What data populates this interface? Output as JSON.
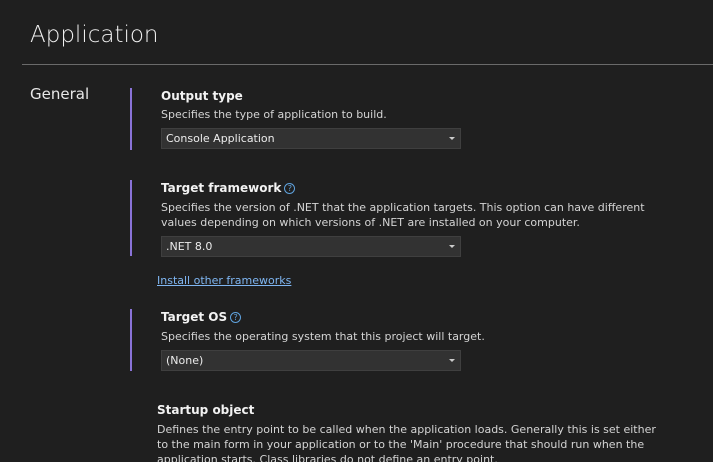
{
  "header": {
    "title": "Application"
  },
  "section": {
    "name": "General"
  },
  "output_type": {
    "label": "Output type",
    "description": "Specifies the type of application to build.",
    "selected": "Console Application"
  },
  "target_framework": {
    "label": "Target framework",
    "description": "Specifies the version of .NET that the application targets. This option can have different values depending on which versions of .NET are installed on your computer.",
    "selected": ".NET 8.0",
    "install_link": "Install other frameworks"
  },
  "target_os": {
    "label": "Target OS",
    "description": "Specifies the operating system that this project will target.",
    "selected": "(None)"
  },
  "startup_object": {
    "label": "Startup object",
    "description": "Defines the entry point to be called when the application loads. Generally this is set either to the main form in your application or to the 'Main' procedure that should run when the application starts. Class libraries do not define an entry point."
  },
  "icons": {
    "help": "help-icon",
    "dropdown": "chevron-down-icon"
  },
  "colors": {
    "accent_bar": "#8a73d8",
    "link": "#7fb6f2",
    "background": "#1f1f1f"
  }
}
